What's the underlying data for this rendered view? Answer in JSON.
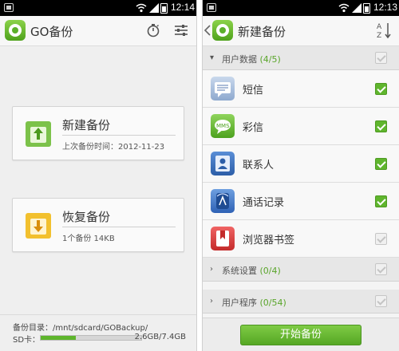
{
  "colors": {
    "accent": "#5fb52d",
    "statusbar": "#000000"
  },
  "left_screen": {
    "status": {
      "time": "12:14"
    },
    "header": {
      "title": "GO备份",
      "icons": [
        "timer-icon",
        "settings-sliders-icon"
      ]
    },
    "new_backup": {
      "title": "新建备份",
      "subtitle": "上次备份时间：2012-11-23"
    },
    "restore": {
      "title": "恢复备份",
      "subtitle": "1个备份  14KB"
    },
    "footer": {
      "directory": "备份目录：/mnt/sdcard/GOBackup/",
      "sd_label": "SD卡：",
      "storage": "2.6GB/7.4GB",
      "storage_used_fraction": 0.35
    }
  },
  "right_screen": {
    "status": {
      "time": "12:13"
    },
    "header": {
      "title": "新建备份",
      "icons": [
        "back-chevron-icon",
        "sort-alpha-icon"
      ]
    },
    "groups": {
      "user_data": {
        "label": "用户数据",
        "count": "(4/5)",
        "expanded": true
      },
      "system_settings": {
        "label": "系统设置",
        "count": "(0/4)",
        "expanded": false
      },
      "user_apps": {
        "label": "用户程序",
        "count": "(0/54)",
        "expanded": false
      }
    },
    "items": [
      {
        "label": "短信",
        "icon": "sms-icon",
        "checked": true
      },
      {
        "label": "彩信",
        "icon": "mms-icon",
        "checked": true
      },
      {
        "label": "联系人",
        "icon": "contacts-icon",
        "checked": true
      },
      {
        "label": "通话记录",
        "icon": "call-log-icon",
        "checked": true
      },
      {
        "label": "浏览器书签",
        "icon": "bookmark-icon",
        "checked": false
      }
    ],
    "start_button": "开始备份"
  }
}
